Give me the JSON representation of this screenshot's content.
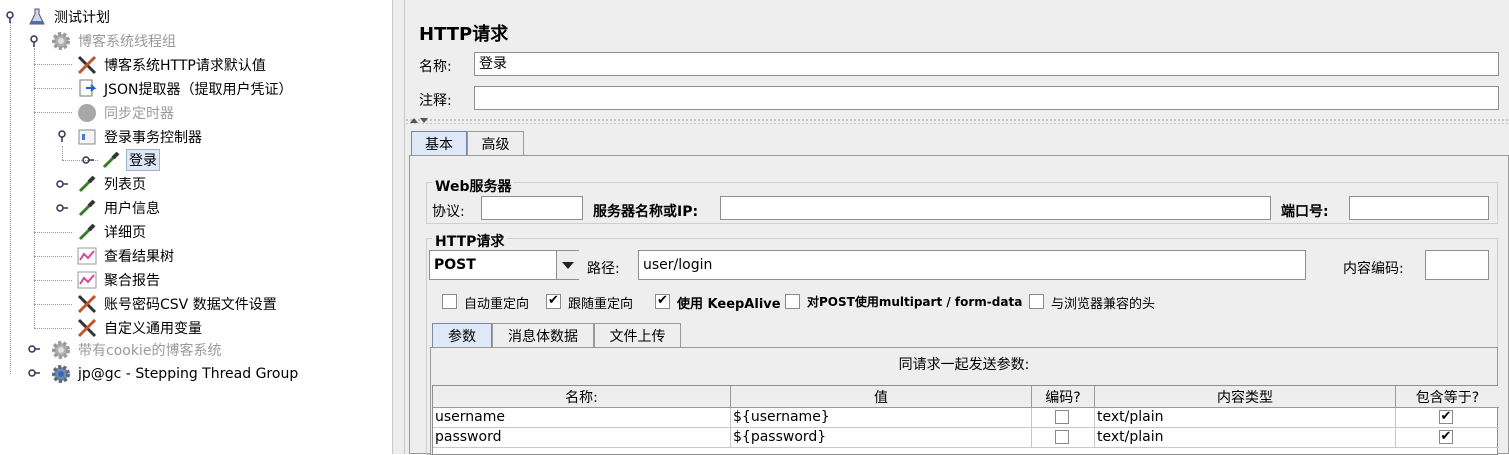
{
  "tree": {
    "nodes": [
      {
        "label": "测试计划",
        "icon": "flask-icon",
        "disabled": false
      },
      {
        "label": "博客系统线程组",
        "icon": "gear-icon",
        "disabled": true
      },
      {
        "label": "博客系统HTTP请求默认值",
        "icon": "wrench-screwdriver-icon",
        "disabled": false
      },
      {
        "label": "JSON提取器（提取用户凭证）",
        "icon": "extractor-icon",
        "disabled": false
      },
      {
        "label": "同步定时器",
        "icon": "timer-icon",
        "disabled": true
      },
      {
        "label": "登录事务控制器",
        "icon": "controller-icon",
        "disabled": false
      },
      {
        "label": "登录",
        "icon": "pipette-icon",
        "disabled": false,
        "selected": true
      },
      {
        "label": "列表页",
        "icon": "pipette-icon",
        "disabled": false
      },
      {
        "label": "用户信息",
        "icon": "pipette-icon",
        "disabled": false
      },
      {
        "label": "详细页",
        "icon": "pipette-icon",
        "disabled": false
      },
      {
        "label": "查看结果树",
        "icon": "chart-icon",
        "disabled": false
      },
      {
        "label": "聚合报告",
        "icon": "chart-icon",
        "disabled": false
      },
      {
        "label": "账号密码CSV 数据文件设置",
        "icon": "wrench-screwdriver-icon",
        "disabled": false
      },
      {
        "label": "自定义通用变量",
        "icon": "wrench-screwdriver-icon",
        "disabled": false
      },
      {
        "label": "带有cookie的博客系统",
        "icon": "gear-icon",
        "disabled": true
      },
      {
        "label": "jp@gc - Stepping Thread Group",
        "icon": "stepping-gear-icon",
        "disabled": false
      }
    ]
  },
  "panel": {
    "title": "HTTP请求",
    "name_label": "名称:",
    "name_value": "登录",
    "comment_label": "注释:",
    "comment_value": "",
    "tabs": [
      {
        "label": "基本"
      },
      {
        "label": "高级"
      }
    ],
    "web_server": {
      "group_label": "Web服务器",
      "protocol_label": "协议:",
      "protocol_value": "",
      "server_label": "服务器名称或IP:",
      "server_value": "",
      "port_label": "端口号:",
      "port_value": ""
    },
    "http_request": {
      "group_label": "HTTP请求",
      "method": "POST",
      "path_label": "路径:",
      "path_value": "user/login",
      "encoding_label": "内容编码:",
      "encoding_value": ""
    },
    "checkboxes": [
      {
        "label": "自动重定向",
        "checked": false
      },
      {
        "label": "跟随重定向",
        "checked": true
      },
      {
        "label": "使用 KeepAlive",
        "checked": true
      },
      {
        "label": "对POST使用multipart / form-data",
        "checked": false
      },
      {
        "label": "与浏览器兼容的头",
        "checked": false
      }
    ],
    "sub_tabs": [
      {
        "label": "参数"
      },
      {
        "label": "消息体数据"
      },
      {
        "label": "文件上传"
      }
    ],
    "params": {
      "caption": "同请求一起发送参数:",
      "headers": [
        "名称:",
        "值",
        "编码?",
        "内容类型",
        "包含等于?"
      ],
      "rows": [
        {
          "name": "username",
          "value": "${username}",
          "encode": false,
          "content_type": "text/plain",
          "include_equals": true
        },
        {
          "name": "password",
          "value": "${password}",
          "encode": false,
          "content_type": "text/plain",
          "include_equals": true
        }
      ]
    }
  }
}
